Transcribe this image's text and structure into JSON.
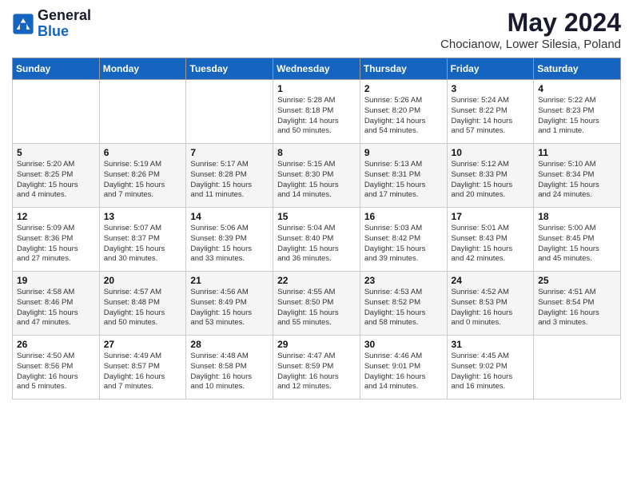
{
  "header": {
    "logo_general": "General",
    "logo_blue": "Blue",
    "title": "May 2024",
    "location": "Chocianow, Lower Silesia, Poland"
  },
  "weekdays": [
    "Sunday",
    "Monday",
    "Tuesday",
    "Wednesday",
    "Thursday",
    "Friday",
    "Saturday"
  ],
  "weeks": [
    [
      {
        "day": "",
        "info": ""
      },
      {
        "day": "",
        "info": ""
      },
      {
        "day": "",
        "info": ""
      },
      {
        "day": "1",
        "info": "Sunrise: 5:28 AM\nSunset: 8:18 PM\nDaylight: 14 hours\nand 50 minutes."
      },
      {
        "day": "2",
        "info": "Sunrise: 5:26 AM\nSunset: 8:20 PM\nDaylight: 14 hours\nand 54 minutes."
      },
      {
        "day": "3",
        "info": "Sunrise: 5:24 AM\nSunset: 8:22 PM\nDaylight: 14 hours\nand 57 minutes."
      },
      {
        "day": "4",
        "info": "Sunrise: 5:22 AM\nSunset: 8:23 PM\nDaylight: 15 hours\nand 1 minute."
      }
    ],
    [
      {
        "day": "5",
        "info": "Sunrise: 5:20 AM\nSunset: 8:25 PM\nDaylight: 15 hours\nand 4 minutes."
      },
      {
        "day": "6",
        "info": "Sunrise: 5:19 AM\nSunset: 8:26 PM\nDaylight: 15 hours\nand 7 minutes."
      },
      {
        "day": "7",
        "info": "Sunrise: 5:17 AM\nSunset: 8:28 PM\nDaylight: 15 hours\nand 11 minutes."
      },
      {
        "day": "8",
        "info": "Sunrise: 5:15 AM\nSunset: 8:30 PM\nDaylight: 15 hours\nand 14 minutes."
      },
      {
        "day": "9",
        "info": "Sunrise: 5:13 AM\nSunset: 8:31 PM\nDaylight: 15 hours\nand 17 minutes."
      },
      {
        "day": "10",
        "info": "Sunrise: 5:12 AM\nSunset: 8:33 PM\nDaylight: 15 hours\nand 20 minutes."
      },
      {
        "day": "11",
        "info": "Sunrise: 5:10 AM\nSunset: 8:34 PM\nDaylight: 15 hours\nand 24 minutes."
      }
    ],
    [
      {
        "day": "12",
        "info": "Sunrise: 5:09 AM\nSunset: 8:36 PM\nDaylight: 15 hours\nand 27 minutes."
      },
      {
        "day": "13",
        "info": "Sunrise: 5:07 AM\nSunset: 8:37 PM\nDaylight: 15 hours\nand 30 minutes."
      },
      {
        "day": "14",
        "info": "Sunrise: 5:06 AM\nSunset: 8:39 PM\nDaylight: 15 hours\nand 33 minutes."
      },
      {
        "day": "15",
        "info": "Sunrise: 5:04 AM\nSunset: 8:40 PM\nDaylight: 15 hours\nand 36 minutes."
      },
      {
        "day": "16",
        "info": "Sunrise: 5:03 AM\nSunset: 8:42 PM\nDaylight: 15 hours\nand 39 minutes."
      },
      {
        "day": "17",
        "info": "Sunrise: 5:01 AM\nSunset: 8:43 PM\nDaylight: 15 hours\nand 42 minutes."
      },
      {
        "day": "18",
        "info": "Sunrise: 5:00 AM\nSunset: 8:45 PM\nDaylight: 15 hours\nand 45 minutes."
      }
    ],
    [
      {
        "day": "19",
        "info": "Sunrise: 4:58 AM\nSunset: 8:46 PM\nDaylight: 15 hours\nand 47 minutes."
      },
      {
        "day": "20",
        "info": "Sunrise: 4:57 AM\nSunset: 8:48 PM\nDaylight: 15 hours\nand 50 minutes."
      },
      {
        "day": "21",
        "info": "Sunrise: 4:56 AM\nSunset: 8:49 PM\nDaylight: 15 hours\nand 53 minutes."
      },
      {
        "day": "22",
        "info": "Sunrise: 4:55 AM\nSunset: 8:50 PM\nDaylight: 15 hours\nand 55 minutes."
      },
      {
        "day": "23",
        "info": "Sunrise: 4:53 AM\nSunset: 8:52 PM\nDaylight: 15 hours\nand 58 minutes."
      },
      {
        "day": "24",
        "info": "Sunrise: 4:52 AM\nSunset: 8:53 PM\nDaylight: 16 hours\nand 0 minutes."
      },
      {
        "day": "25",
        "info": "Sunrise: 4:51 AM\nSunset: 8:54 PM\nDaylight: 16 hours\nand 3 minutes."
      }
    ],
    [
      {
        "day": "26",
        "info": "Sunrise: 4:50 AM\nSunset: 8:56 PM\nDaylight: 16 hours\nand 5 minutes."
      },
      {
        "day": "27",
        "info": "Sunrise: 4:49 AM\nSunset: 8:57 PM\nDaylight: 16 hours\nand 7 minutes."
      },
      {
        "day": "28",
        "info": "Sunrise: 4:48 AM\nSunset: 8:58 PM\nDaylight: 16 hours\nand 10 minutes."
      },
      {
        "day": "29",
        "info": "Sunrise: 4:47 AM\nSunset: 8:59 PM\nDaylight: 16 hours\nand 12 minutes."
      },
      {
        "day": "30",
        "info": "Sunrise: 4:46 AM\nSunset: 9:01 PM\nDaylight: 16 hours\nand 14 minutes."
      },
      {
        "day": "31",
        "info": "Sunrise: 4:45 AM\nSunset: 9:02 PM\nDaylight: 16 hours\nand 16 minutes."
      },
      {
        "day": "",
        "info": ""
      }
    ]
  ]
}
